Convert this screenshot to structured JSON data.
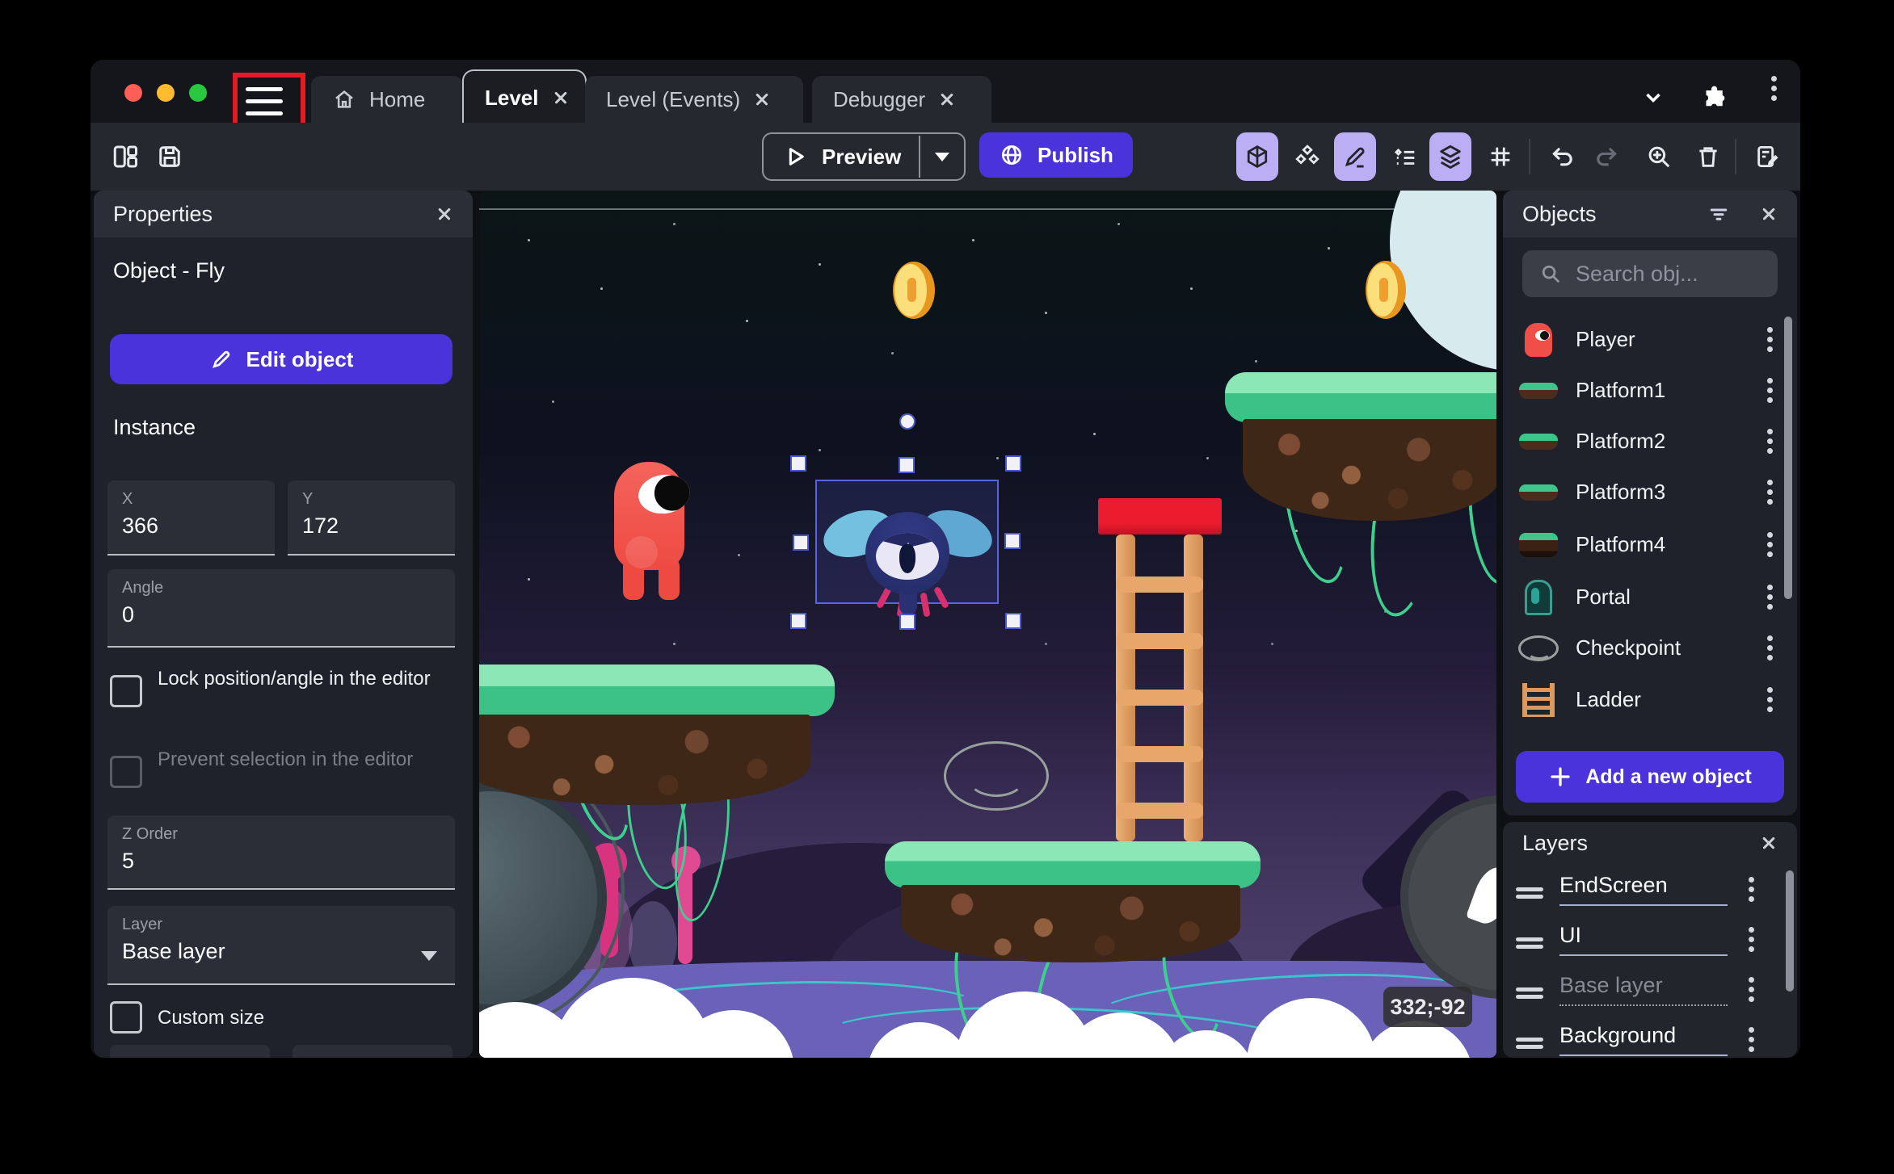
{
  "titlebar": {
    "tabs": [
      {
        "label": "Home"
      },
      {
        "label": "Level"
      },
      {
        "label": "Level (Events)"
      },
      {
        "label": "Debugger"
      }
    ]
  },
  "toolbar": {
    "preview_label": "Preview",
    "publish_label": "Publish"
  },
  "properties": {
    "title": "Properties",
    "object_heading": "Object - Fly",
    "edit_object_label": "Edit object",
    "section_instance": "Instance",
    "fields": {
      "x": {
        "label": "X",
        "value": "366"
      },
      "y": {
        "label": "Y",
        "value": "172"
      },
      "angle": {
        "label": "Angle",
        "value": "0"
      },
      "z_order": {
        "label": "Z Order",
        "value": "5"
      },
      "layer": {
        "label": "Layer",
        "value": "Base layer"
      }
    },
    "checkboxes": [
      {
        "label": "Lock position/angle in the editor",
        "checked": false
      },
      {
        "label": "Prevent selection in the editor",
        "checked": false,
        "disabled": true
      },
      {
        "label": "Custom size",
        "checked": false
      }
    ]
  },
  "objects": {
    "title": "Objects",
    "search_placeholder": "Search obj...",
    "items": [
      "Player",
      "Platform1",
      "Platform2",
      "Platform3",
      "Platform4",
      "Portal",
      "Checkpoint",
      "Ladder"
    ],
    "add_button_label": "Add a new object"
  },
  "layers": {
    "title": "Layers",
    "items": [
      {
        "name": "EndScreen",
        "muted": false
      },
      {
        "name": "UI",
        "muted": false
      },
      {
        "name": "Base layer",
        "muted": true
      },
      {
        "name": "Background",
        "muted": false
      }
    ]
  },
  "canvas": {
    "coordinate_badge": "332;-92"
  },
  "colors": {
    "accent_purple": "#4a33db",
    "icon_highlight": "#bcaef5",
    "selection_blue": "#5767e3",
    "annotation_red": "#e31b23",
    "grass_green": "#3fc48b",
    "coin_gold": "#f5c842"
  }
}
